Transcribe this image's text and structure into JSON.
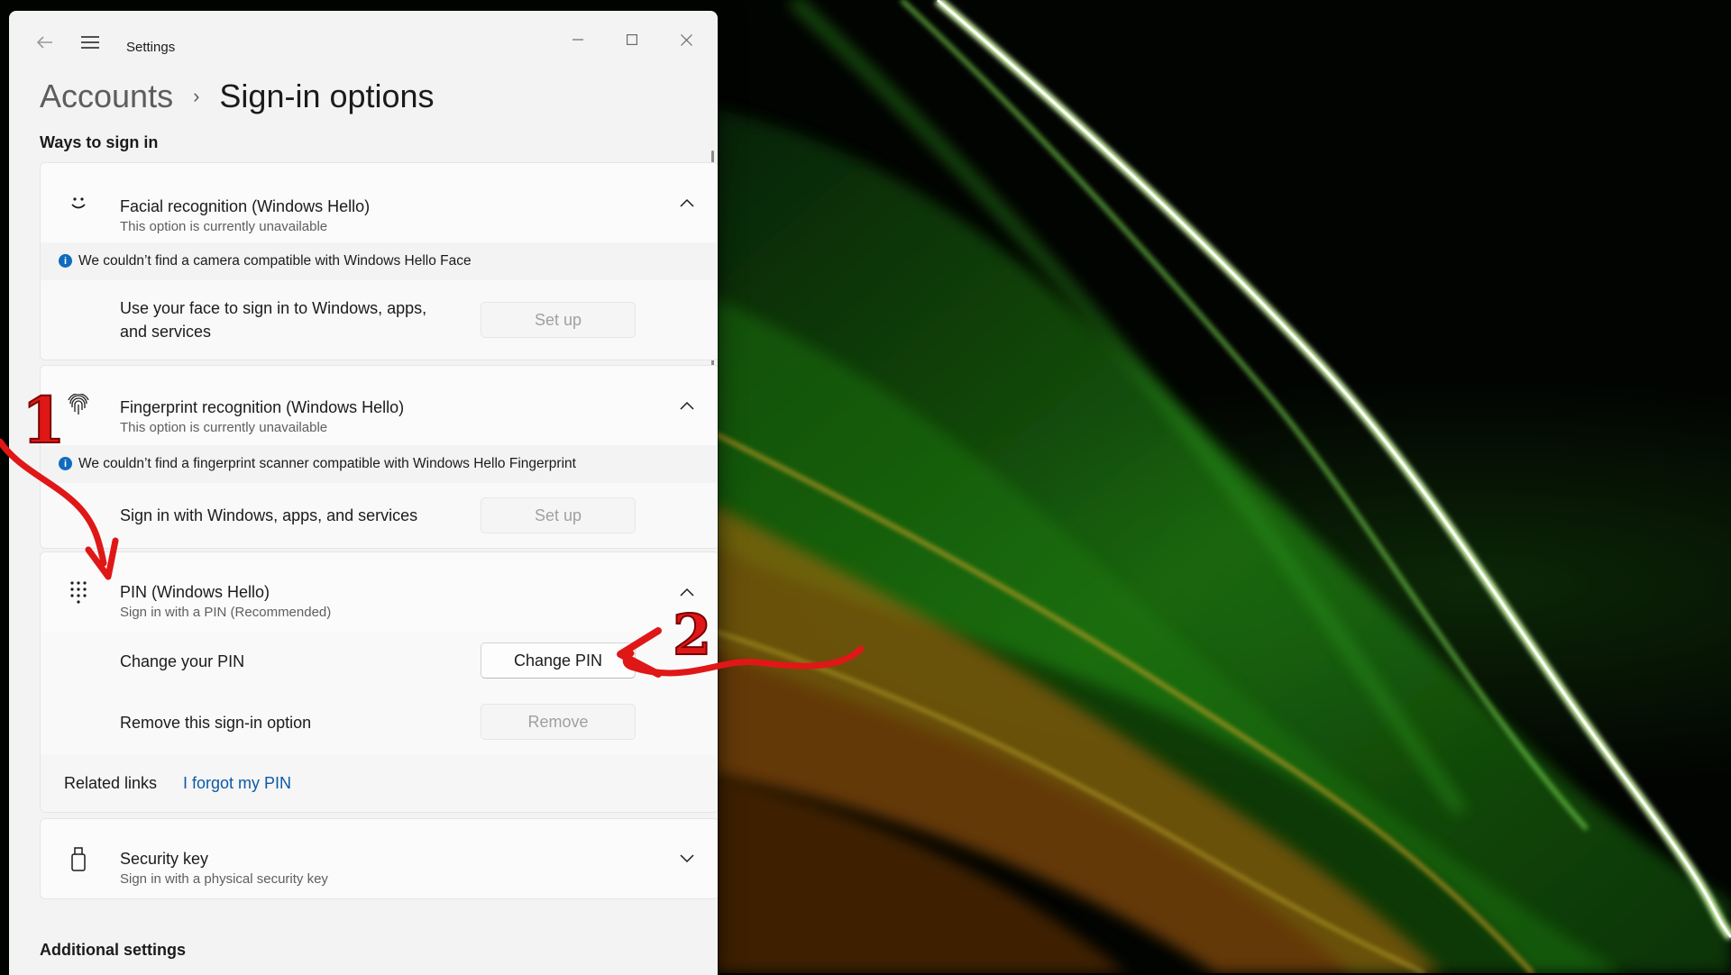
{
  "window": {
    "title": "Settings",
    "back_icon": "back-arrow-icon",
    "menu_icon": "hamburger-menu-icon",
    "controls": {
      "minimize": "–",
      "maximize": "☐",
      "close": "✕"
    }
  },
  "breadcrumb": {
    "parent": "Accounts",
    "separator": "›",
    "current": "Sign-in options"
  },
  "ways_section": {
    "title": "Ways to sign in"
  },
  "facial": {
    "title": "Facial recognition (Windows Hello)",
    "subtitle": "This option is currently unavailable",
    "icon": "face-icon",
    "expanded": true,
    "info": "We couldn’t find a camera compatible with Windows Hello Face",
    "setup_text_line1": "Use your face to sign in to Windows, apps,",
    "setup_text_line2": "and services",
    "setup_button": "Set up"
  },
  "fingerprint": {
    "title": "Fingerprint recognition (Windows Hello)",
    "subtitle": "This option is currently unavailable",
    "icon": "fingerprint-icon",
    "expanded": true,
    "info": "We couldn’t find a fingerprint scanner compatible with Windows Hello Fingerprint",
    "setup_text": "Sign in with Windows, apps, and services",
    "setup_button": "Set up"
  },
  "pin": {
    "title": "PIN (Windows Hello)",
    "subtitle": "Sign in with a PIN (Recommended)",
    "icon": "pin-keypad-icon",
    "expanded": true,
    "change_text": "Change your PIN",
    "change_button": "Change PIN",
    "remove_text": "Remove this sign-in option",
    "remove_button": "Remove",
    "related_label": "Related links",
    "related_link": "I forgot my PIN"
  },
  "security_key": {
    "title": "Security key",
    "subtitle": "Sign in with a physical security key",
    "icon": "usb-key-icon",
    "expanded": false
  },
  "additional_section": {
    "title": "Additional settings"
  },
  "annotations": {
    "marker_1": "1",
    "marker_2": "2",
    "color": "#e01717"
  },
  "colors": {
    "window_bg": "#f3f3f3",
    "card_bg": "#fbfbfb",
    "link": "#0a5aa8",
    "info_accent": "#0f6cbd",
    "wallpaper_green": "#3fbf1f",
    "wallpaper_orange": "#d97a10"
  }
}
